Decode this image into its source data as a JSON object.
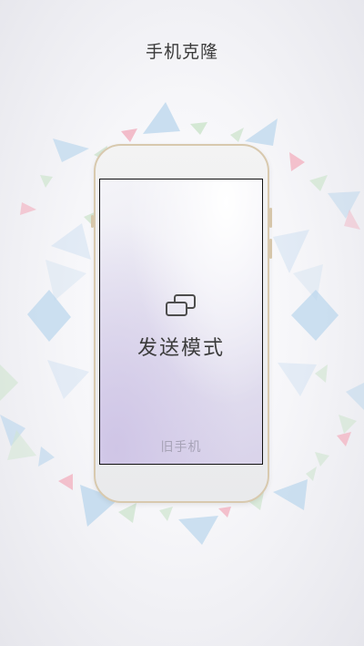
{
  "header": {
    "title": "手机克隆"
  },
  "phone_screen": {
    "icon": "send-mode-icon",
    "mode_label": "发送模式",
    "role_label": "旧手机"
  },
  "colors": {
    "background": "#f2f2f5",
    "phone_frame": "#d8c9ae",
    "shape_blue": "#b7d3ea",
    "shape_pink": "#f2b3c2",
    "shape_green": "#cfe6cf"
  }
}
